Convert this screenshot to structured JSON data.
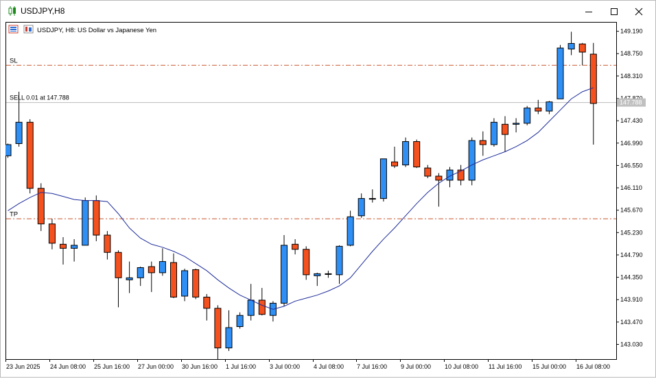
{
  "window": {
    "title": "USDJPY,H8"
  },
  "chart_header": {
    "text": "USDJPY, H8:  US Dollar vs Japanese Yen"
  },
  "lines": {
    "sl_label": "SL",
    "tp_label": "TP",
    "order_label": "SELL 0.01 at 147.788",
    "price_tag": "147.788",
    "sl_price": 148.52,
    "tp_price": 145.5,
    "order_price": 147.788
  },
  "colors": {
    "bull": "#2f8ff5",
    "bear": "#f4511e",
    "ma": "#1c2b9a",
    "level_line": "#c8552a",
    "order_line": "#bbbbbb"
  },
  "chart_data": {
    "type": "candlestick",
    "symbol": "USDJPY",
    "timeframe": "H8",
    "ylim": [
      142.74,
      149.36
    ],
    "y_ticks": [
      "149.190",
      "148.750",
      "148.310",
      "147.870",
      "147.430",
      "146.990",
      "146.550",
      "146.110",
      "145.670",
      "145.230",
      "144.790",
      "144.350",
      "143.910",
      "143.470",
      "143.030"
    ],
    "x_labels": [
      "23 Jun 2025",
      "24 Jun 08:00",
      "25 Jun 16:00",
      "27 Jun 00:00",
      "30 Jun 16:00",
      "1 Jul 16:00",
      "3 Jul 00:00",
      "4 Jul 08:00",
      "7 Jul 16:00",
      "9 Jul 00:00",
      "10 Jul 08:00",
      "11 Jul 16:00",
      "15 Jul 00:00",
      "16 Jul 08:00"
    ],
    "candles": [
      {
        "o": 146.74,
        "h": 146.98,
        "l": 146.7,
        "c": 146.96
      },
      {
        "o": 146.98,
        "h": 148.0,
        "l": 146.92,
        "c": 147.4
      },
      {
        "o": 147.4,
        "h": 147.46,
        "l": 146.0,
        "c": 146.1
      },
      {
        "o": 146.1,
        "h": 146.2,
        "l": 145.26,
        "c": 145.4
      },
      {
        "o": 145.4,
        "h": 145.5,
        "l": 144.9,
        "c": 145.02
      },
      {
        "o": 145.0,
        "h": 145.14,
        "l": 144.6,
        "c": 144.92
      },
      {
        "o": 144.92,
        "h": 145.1,
        "l": 144.66,
        "c": 144.98
      },
      {
        "o": 144.98,
        "h": 145.92,
        "l": 144.98,
        "c": 145.86
      },
      {
        "o": 145.86,
        "h": 145.96,
        "l": 145.06,
        "c": 145.18
      },
      {
        "o": 145.18,
        "h": 145.26,
        "l": 144.7,
        "c": 144.84
      },
      {
        "o": 144.84,
        "h": 144.88,
        "l": 143.76,
        "c": 144.34
      },
      {
        "o": 144.3,
        "h": 144.66,
        "l": 144.04,
        "c": 144.34
      },
      {
        "o": 144.34,
        "h": 144.56,
        "l": 144.18,
        "c": 144.54
      },
      {
        "o": 144.56,
        "h": 144.66,
        "l": 144.06,
        "c": 144.44
      },
      {
        "o": 144.44,
        "h": 144.92,
        "l": 144.38,
        "c": 144.66
      },
      {
        "o": 144.64,
        "h": 144.82,
        "l": 143.94,
        "c": 143.96
      },
      {
        "o": 143.98,
        "h": 144.52,
        "l": 143.88,
        "c": 144.48
      },
      {
        "o": 144.5,
        "h": 144.52,
        "l": 143.92,
        "c": 143.96
      },
      {
        "o": 143.96,
        "h": 144.02,
        "l": 143.5,
        "c": 143.74
      },
      {
        "o": 143.74,
        "h": 143.8,
        "l": 142.74,
        "c": 142.96
      },
      {
        "o": 142.96,
        "h": 143.7,
        "l": 142.9,
        "c": 143.36
      },
      {
        "o": 143.38,
        "h": 143.66,
        "l": 143.34,
        "c": 143.6
      },
      {
        "o": 143.6,
        "h": 144.22,
        "l": 143.5,
        "c": 143.9
      },
      {
        "o": 143.9,
        "h": 144.14,
        "l": 143.6,
        "c": 143.62
      },
      {
        "o": 143.6,
        "h": 143.88,
        "l": 143.48,
        "c": 143.84
      },
      {
        "o": 143.84,
        "h": 145.18,
        "l": 143.78,
        "c": 144.98
      },
      {
        "o": 145.0,
        "h": 145.1,
        "l": 144.8,
        "c": 144.9
      },
      {
        "o": 144.9,
        "h": 144.96,
        "l": 144.3,
        "c": 144.4
      },
      {
        "o": 144.38,
        "h": 144.44,
        "l": 144.18,
        "c": 144.42
      },
      {
        "o": 144.42,
        "h": 144.48,
        "l": 144.34,
        "c": 144.42
      },
      {
        "o": 144.4,
        "h": 144.98,
        "l": 144.22,
        "c": 144.96
      },
      {
        "o": 144.98,
        "h": 145.66,
        "l": 144.96,
        "c": 145.54
      },
      {
        "o": 145.56,
        "h": 146.0,
        "l": 145.52,
        "c": 145.9
      },
      {
        "o": 145.9,
        "h": 146.08,
        "l": 145.82,
        "c": 145.9
      },
      {
        "o": 145.9,
        "h": 146.26,
        "l": 145.84,
        "c": 146.68
      },
      {
        "o": 146.62,
        "h": 146.92,
        "l": 146.5,
        "c": 146.54
      },
      {
        "o": 146.56,
        "h": 147.1,
        "l": 146.52,
        "c": 147.02
      },
      {
        "o": 147.02,
        "h": 147.06,
        "l": 146.5,
        "c": 146.52
      },
      {
        "o": 146.5,
        "h": 146.56,
        "l": 146.3,
        "c": 146.34
      },
      {
        "o": 146.34,
        "h": 146.4,
        "l": 145.74,
        "c": 146.26
      },
      {
        "o": 146.26,
        "h": 146.52,
        "l": 146.12,
        "c": 146.46
      },
      {
        "o": 146.46,
        "h": 146.56,
        "l": 146.16,
        "c": 146.26
      },
      {
        "o": 146.26,
        "h": 147.1,
        "l": 146.16,
        "c": 147.04
      },
      {
        "o": 147.04,
        "h": 147.22,
        "l": 146.74,
        "c": 146.96
      },
      {
        "o": 146.96,
        "h": 147.48,
        "l": 146.92,
        "c": 147.4
      },
      {
        "o": 147.36,
        "h": 147.52,
        "l": 146.82,
        "c": 147.16
      },
      {
        "o": 147.36,
        "h": 147.48,
        "l": 147.2,
        "c": 147.38
      },
      {
        "o": 147.38,
        "h": 147.72,
        "l": 147.34,
        "c": 147.68
      },
      {
        "o": 147.68,
        "h": 147.84,
        "l": 147.56,
        "c": 147.62
      },
      {
        "o": 147.62,
        "h": 147.82,
        "l": 147.56,
        "c": 147.8
      },
      {
        "o": 147.86,
        "h": 148.92,
        "l": 147.86,
        "c": 148.86
      },
      {
        "o": 148.84,
        "h": 149.18,
        "l": 148.72,
        "c": 148.95
      },
      {
        "o": 148.94,
        "h": 148.96,
        "l": 148.52,
        "c": 148.78
      },
      {
        "o": 148.74,
        "h": 148.96,
        "l": 146.96,
        "c": 147.77
      }
    ],
    "moving_average": [
      145.66,
      145.8,
      145.92,
      146.02,
      146.0,
      145.94,
      145.88,
      145.86,
      145.86,
      145.84,
      145.6,
      145.32,
      145.12,
      145.0,
      144.94,
      144.86,
      144.76,
      144.62,
      144.48,
      144.3,
      144.14,
      144.0,
      143.9,
      143.8,
      143.72,
      143.78,
      143.88,
      143.94,
      144.0,
      144.08,
      144.18,
      144.34,
      144.6,
      144.86,
      145.1,
      145.32,
      145.56,
      145.8,
      146.02,
      146.2,
      146.34,
      146.44,
      146.56,
      146.66,
      146.74,
      146.82,
      146.92,
      147.04,
      147.2,
      147.42,
      147.64,
      147.86,
      148.0,
      148.08
    ]
  }
}
